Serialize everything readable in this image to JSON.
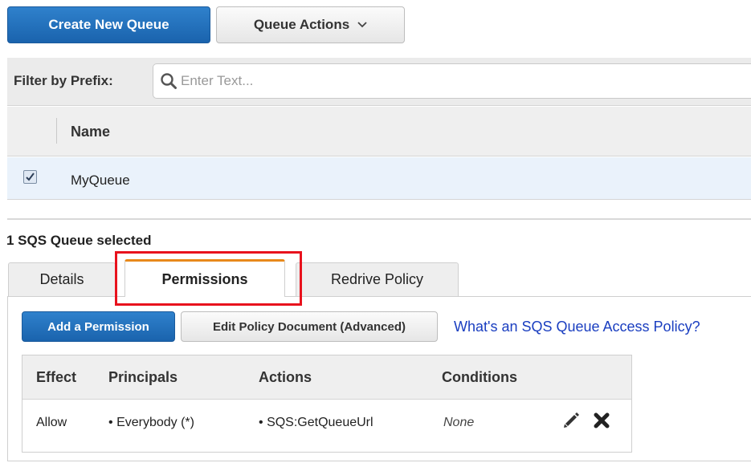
{
  "toolbar": {
    "create_label": "Create New Queue",
    "actions_label": "Queue Actions"
  },
  "filter": {
    "label": "Filter by Prefix:",
    "placeholder": "Enter Text..."
  },
  "queue_table": {
    "columns": [
      "Name"
    ],
    "rows": [
      {
        "name": "MyQueue",
        "checked": true
      }
    ]
  },
  "selection_text": "1 SQS Queue selected",
  "tabs": [
    {
      "label": "Details",
      "active": false
    },
    {
      "label": "Permissions",
      "active": true
    },
    {
      "label": "Redrive Policy",
      "active": false
    }
  ],
  "permissions": {
    "add_label": "Add a Permission",
    "edit_label": "Edit Policy Document (Advanced)",
    "help_link": "What's an SQS Queue Access Policy?",
    "columns": [
      "Effect",
      "Principals",
      "Actions",
      "Conditions"
    ],
    "rows": [
      {
        "effect": "Allow",
        "principals": "Everybody (*)",
        "actions": "SQS:GetQueueUrl",
        "conditions": "None"
      }
    ]
  },
  "colors": {
    "primary_button": "#1a63ad",
    "active_tab_accent": "#e8891b",
    "highlight_box": "#e8121d",
    "link": "#1a3ec0",
    "selected_row": "#eaf2fb"
  },
  "icons": [
    "search-icon",
    "chevron-down-icon",
    "checkbox-checked-icon",
    "pencil-icon",
    "close-icon",
    "bullet-icon"
  ]
}
